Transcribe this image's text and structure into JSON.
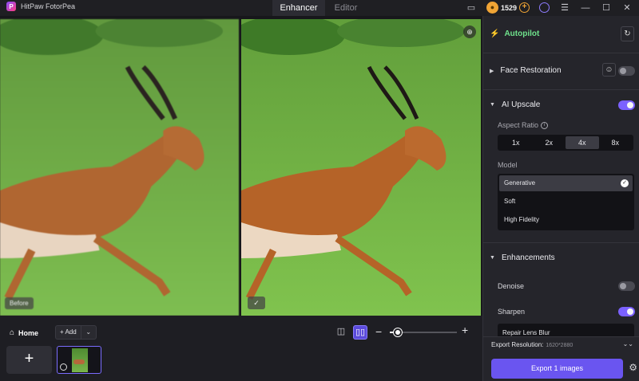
{
  "app": {
    "title": "HitPaw FotorPea",
    "logo_letter": "P"
  },
  "tabs": [
    {
      "label": "Enhancer"
    },
    {
      "label": "Editor"
    }
  ],
  "titlebar": {
    "credits": "1529"
  },
  "preview": {
    "before_label": "Before"
  },
  "bottom": {
    "home_label": "Home",
    "add_label": "Add"
  },
  "panel": {
    "autopilot": "Autopilot",
    "face_restoration": "Face Restoration",
    "ai_upscale": "AI Upscale",
    "aspect_ratio_label": "Aspect Ratio",
    "aspect_options": [
      "1x",
      "2x",
      "4x",
      "8x"
    ],
    "aspect_selected": "4x",
    "model_label": "Model",
    "models": [
      "Generative",
      "Soft",
      "High Fidelity"
    ],
    "model_selected": "Generative",
    "enhancements": "Enhancements",
    "denoise": "Denoise",
    "sharpen": "Sharpen",
    "repair_option": "Repair Lens Blur",
    "export_resolution_label": "Export Resolution:",
    "export_resolution_value": "1620*2880",
    "export_button": "Export 1 images"
  },
  "toggles": {
    "face_restoration": false,
    "ai_upscale": true,
    "denoise": false,
    "sharpen": true
  },
  "colors": {
    "accent": "#6a55f0",
    "autopilot_green": "#6fe28c",
    "coin": "#f0a435"
  }
}
